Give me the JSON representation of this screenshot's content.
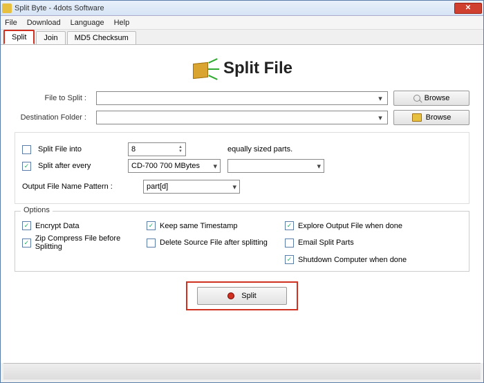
{
  "window": {
    "title": "Split Byte - 4dots Software"
  },
  "menu": {
    "file": "File",
    "download": "Download",
    "language": "Language",
    "help": "Help"
  },
  "tabs": {
    "split": "Split",
    "join": "Join",
    "md5": "MD5 Checksum"
  },
  "heading": "Split File",
  "labels": {
    "file_to_split": "File to Split :",
    "destination": "Destination Folder :",
    "browse": "Browse",
    "split_into": "Split File into",
    "equally": "equally sized parts.",
    "split_after": "Split after every",
    "pattern": "Output File Name Pattern :",
    "options": "Options"
  },
  "values": {
    "parts": "8",
    "cd": "CD-700 700 MBytes",
    "pattern": "part[d]"
  },
  "options": {
    "encrypt": "Encrypt Data",
    "zip": "Zip Compress File before Splitting",
    "timestamp": "Keep same Timestamp",
    "delete": "Delete Source File after splitting",
    "explore": "Explore Output File when done",
    "email": "Email Split Parts",
    "shutdown": "Shutdown Computer when done"
  },
  "actions": {
    "split": "Split"
  },
  "checked": {
    "split_into": false,
    "split_after": true,
    "encrypt": true,
    "zip": true,
    "timestamp": true,
    "delete": false,
    "explore": true,
    "email": false,
    "shutdown": true
  }
}
